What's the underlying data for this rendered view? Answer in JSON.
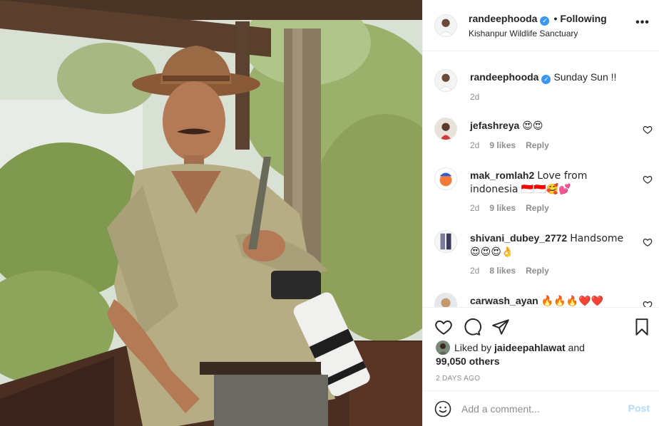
{
  "post": {
    "author": "randeephooda",
    "separator": "•",
    "follow_status": "Following",
    "location": "Kishanpur Wildlife Sanctuary",
    "more_icon": "more-horizontal-icon",
    "verified_icon": "verified-badge-icon"
  },
  "caption": {
    "username": "randeephooda",
    "text": "Sunday Sun !!",
    "time": "2d"
  },
  "comments": [
    {
      "username": "jefashreya",
      "text": "😍😍",
      "time": "2d",
      "likes": "9 likes",
      "reply": "Reply"
    },
    {
      "username": "mak_romlah2",
      "text": "Love from indonesia 🇮🇩🇮🇩🥰💕",
      "time": "2d",
      "likes": "9 likes",
      "reply": "Reply"
    },
    {
      "username": "shivani_dubey_2772",
      "text": "Handsome 😍😍😍👌",
      "time": "2d",
      "likes": "8 likes",
      "reply": "Reply"
    },
    {
      "username": "carwash_ayan",
      "text": "🔥🔥🔥❤️❤️",
      "time": "",
      "likes": "",
      "reply": ""
    }
  ],
  "likes": {
    "prefix": "Liked by",
    "user": "jaideepahlawat",
    "and": "and",
    "others": "99,050 others"
  },
  "date": "2 DAYS AGO",
  "comment_box": {
    "placeholder": "Add a comment...",
    "post_label": "Post"
  },
  "colors": {
    "accent": "#3897f0",
    "post_disabled": "#b3dbff",
    "muted": "#8e8e8e",
    "text": "#262626"
  }
}
